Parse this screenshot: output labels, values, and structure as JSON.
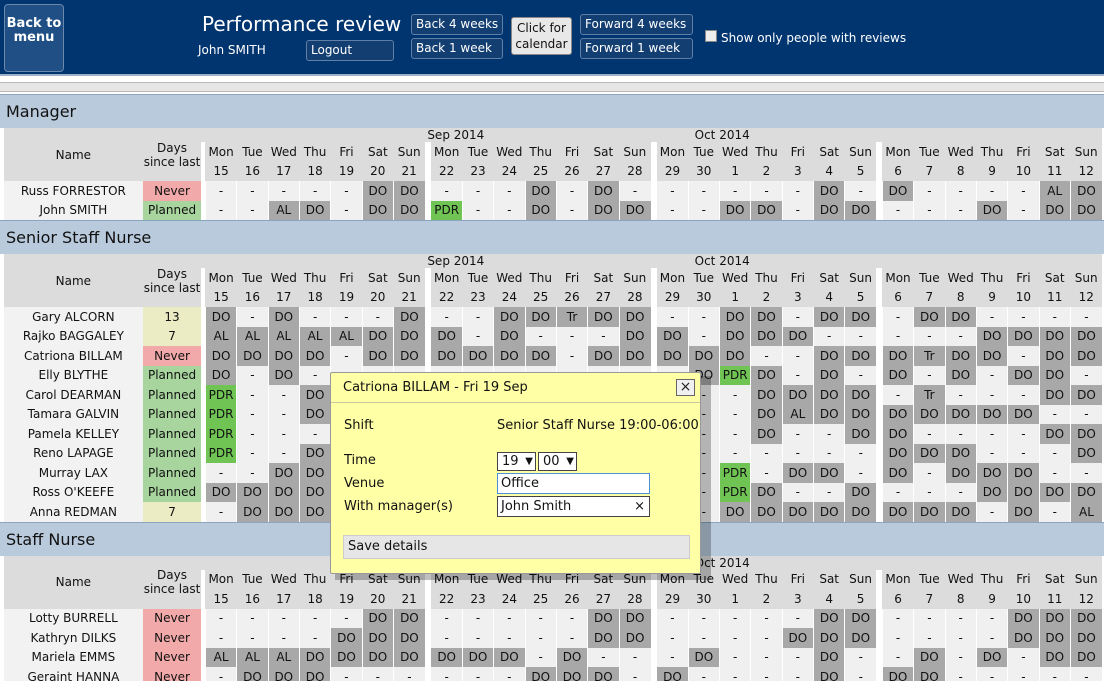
{
  "header": {
    "back_label": "Back to menu",
    "title": "Performance review",
    "user": "John SMITH",
    "logout": "Logout",
    "back4": "Back 4 weeks",
    "back1": "Back 1 week",
    "calendar": "Click for calendar",
    "fwd4": "Forward 4 weeks",
    "fwd1": "Forward 1 week",
    "show_only": "Show only people with reviews"
  },
  "table_header": {
    "name": "Name",
    "days_since": "Days since last",
    "month1": "Sep 2014",
    "month2": "Oct 2014",
    "weeks": [
      [
        [
          "Mon",
          "15"
        ],
        [
          "Tue",
          "16"
        ],
        [
          "Wed",
          "17"
        ],
        [
          "Thu",
          "18"
        ],
        [
          "Fri",
          "19"
        ],
        [
          "Sat",
          "20"
        ],
        [
          "Sun",
          "21"
        ]
      ],
      [
        [
          "Mon",
          "22"
        ],
        [
          "Tue",
          "23"
        ],
        [
          "Wed",
          "24"
        ],
        [
          "Thu",
          "25"
        ],
        [
          "Fri",
          "26"
        ],
        [
          "Sat",
          "27"
        ],
        [
          "Sun",
          "28"
        ]
      ],
      [
        [
          "Mon",
          "29"
        ],
        [
          "Tue",
          "30"
        ],
        [
          "Wed",
          "1"
        ],
        [
          "Thu",
          "2"
        ],
        [
          "Fri",
          "3"
        ],
        [
          "Sat",
          "4"
        ],
        [
          "Sun",
          "5"
        ]
      ],
      [
        [
          "Mon",
          "6"
        ],
        [
          "Tue",
          "7"
        ],
        [
          "Wed",
          "8"
        ],
        [
          "Thu",
          "9"
        ],
        [
          "Fri",
          "10"
        ],
        [
          "Sat",
          "11"
        ],
        [
          "Sun",
          "12"
        ]
      ]
    ]
  },
  "sections": [
    {
      "title": "Manager",
      "rows": [
        {
          "name": "Russ FORRESTOR",
          "days": "Never",
          "cells": [
            "-",
            "-",
            "-",
            "-",
            "-",
            "DO",
            "DO",
            "-",
            "-",
            "-",
            "DO",
            "-",
            "DO",
            "-",
            "-",
            "-",
            "-",
            "-",
            "-",
            "DO",
            "-",
            "DO",
            "-",
            "-",
            "-",
            "-",
            "AL",
            "DO"
          ]
        },
        {
          "name": "John SMITH",
          "days": "Planned",
          "cells": [
            "-",
            "-",
            "AL",
            "DO",
            "-",
            "DO",
            "DO",
            "PDR",
            "-",
            "-",
            "DO",
            "-",
            "DO",
            "DO",
            "-",
            "-",
            "DO",
            "DO",
            "-",
            "DO",
            "DO",
            "-",
            "-",
            "-",
            "DO",
            "-",
            "DO",
            "DO"
          ]
        }
      ]
    },
    {
      "title": "Senior Staff Nurse",
      "rows": [
        {
          "name": "Gary ALCORN",
          "days": "13",
          "cells": [
            "DO",
            "-",
            "DO",
            "-",
            "-",
            "-",
            "DO",
            "-",
            "-",
            "DO",
            "DO",
            "Tr",
            "DO",
            "DO",
            "-",
            "-",
            "DO",
            "DO",
            "-",
            "DO",
            "DO",
            "-",
            "DO",
            "DO",
            "-",
            "-",
            "-",
            "-"
          ]
        },
        {
          "name": "Rajko BAGGALEY",
          "days": "7",
          "cells": [
            "AL",
            "AL",
            "AL",
            "AL",
            "AL",
            "DO",
            "DO",
            "DO",
            "-",
            "DO",
            "-",
            "-",
            "-",
            "DO",
            "DO",
            "-",
            "DO",
            "DO",
            "DO",
            "-",
            "-",
            "-",
            "-",
            "-",
            "DO",
            "DO",
            "DO",
            "DO"
          ]
        },
        {
          "name": "Catriona BILLAM",
          "days": "Never",
          "cells": [
            "DO",
            "DO",
            "DO",
            "DO",
            "-",
            "DO",
            "DO",
            "DO",
            "DO",
            "DO",
            "DO",
            "-",
            "DO",
            "DO",
            "DO",
            "DO",
            "DO",
            "-",
            "-",
            "DO",
            "DO",
            "DO",
            "Tr",
            "DO",
            "DO",
            "-",
            "DO",
            "DO"
          ]
        },
        {
          "name": "Elly BLYTHE",
          "days": "Planned",
          "cells": [
            "DO",
            "-",
            "DO",
            "-",
            "-",
            "-",
            "-",
            "-",
            "-",
            "-",
            "-",
            "-",
            "-",
            "-",
            "-",
            "DO",
            "PDR",
            "DO",
            "-",
            "DO",
            "-",
            "DO",
            "-",
            "DO",
            "-",
            "DO",
            "DO",
            "-"
          ]
        },
        {
          "name": "Carol DEARMAN",
          "days": "Planned",
          "cells": [
            "PDR",
            "-",
            "-",
            "DO",
            "-",
            "-",
            "-",
            "-",
            "-",
            "-",
            "-",
            "-",
            "-",
            "-",
            "-",
            "-",
            "-",
            "DO",
            "DO",
            "DO",
            "DO",
            "-",
            "Tr",
            "-",
            "-",
            "-",
            "DO",
            "DO"
          ]
        },
        {
          "name": "Tamara GALVIN",
          "days": "Planned",
          "cells": [
            "PDR",
            "-",
            "-",
            "DO",
            "-",
            "-",
            "-",
            "-",
            "-",
            "-",
            "-",
            "-",
            "-",
            "-",
            "-",
            "-",
            "-",
            "DO",
            "AL",
            "DO",
            "DO",
            "DO",
            "DO",
            "DO",
            "DO",
            "DO",
            "-",
            "-"
          ]
        },
        {
          "name": "Pamela KELLEY",
          "days": "Planned",
          "cells": [
            "PDR",
            "-",
            "-",
            "-",
            "-",
            "-",
            "-",
            "-",
            "-",
            "-",
            "-",
            "-",
            "-",
            "-",
            "-",
            "-",
            "-",
            "DO",
            "-",
            "-",
            "DO",
            "DO",
            "-",
            "-",
            "-",
            "-",
            "DO",
            "DO"
          ]
        },
        {
          "name": "Reno LAPAGE",
          "days": "Planned",
          "cells": [
            "PDR",
            "-",
            "-",
            "DO",
            "-",
            "-",
            "-",
            "-",
            "-",
            "-",
            "-",
            "-",
            "-",
            "-",
            "-",
            "-",
            "-",
            "-",
            "-",
            "-",
            "-",
            "DO",
            "DO",
            "DO",
            "-",
            "-",
            "-",
            "DO"
          ]
        },
        {
          "name": "Murray LAX",
          "days": "Planned",
          "cells": [
            "-",
            "-",
            "DO",
            "DO",
            "-",
            "-",
            "-",
            "-",
            "-",
            "-",
            "-",
            "-",
            "-",
            "-",
            "-",
            "-",
            "PDR",
            "-",
            "DO",
            "DO",
            "-",
            "DO",
            "-",
            "DO",
            "DO",
            "DO",
            "-",
            "-"
          ]
        },
        {
          "name": "Ross O'KEEFE",
          "days": "Planned",
          "cells": [
            "DO",
            "DO",
            "DO",
            "DO",
            "-",
            "-",
            "-",
            "-",
            "-",
            "-",
            "-",
            "-",
            "-",
            "-",
            "-",
            "-",
            "PDR",
            "DO",
            "-",
            "-",
            "DO",
            "-",
            "-",
            "-",
            "DO",
            "DO",
            "DO",
            "DO"
          ]
        },
        {
          "name": "Anna REDMAN",
          "days": "7",
          "cells": [
            "-",
            "DO",
            "DO",
            "DO",
            "-",
            "-",
            "-",
            "-",
            "-",
            "-",
            "-",
            "-",
            "-",
            "-",
            "-",
            "-",
            "DO",
            "DO",
            "DO",
            "DO",
            "DO",
            "DO",
            "DO",
            "DO",
            "-",
            "DO",
            "-",
            "AL"
          ]
        }
      ]
    },
    {
      "title": "Staff Nurse",
      "rows": [
        {
          "name": "Lotty BURRELL",
          "days": "Never",
          "cells": [
            "-",
            "-",
            "-",
            "-",
            "-",
            "DO",
            "DO",
            "-",
            "-",
            "-",
            "-",
            "-",
            "DO",
            "DO",
            "-",
            "-",
            "-",
            "-",
            "-",
            "DO",
            "DO",
            "-",
            "-",
            "-",
            "-",
            "DO",
            "DO",
            "DO"
          ]
        },
        {
          "name": "Kathryn DILKS",
          "days": "Never",
          "cells": [
            "-",
            "-",
            "-",
            "-",
            "DO",
            "DO",
            "DO",
            "-",
            "-",
            "-",
            "-",
            "-",
            "DO",
            "DO",
            "-",
            "-",
            "-",
            "-",
            "DO",
            "DO",
            "DO",
            "-",
            "-",
            "-",
            "-",
            "DO",
            "DO",
            "DO"
          ]
        },
        {
          "name": "Mariela EMMS",
          "days": "Never",
          "cells": [
            "AL",
            "AL",
            "AL",
            "DO",
            "DO",
            "DO",
            "DO",
            "DO",
            "DO",
            "DO",
            "-",
            "DO",
            "-",
            "-",
            "-",
            "DO",
            "-",
            "-",
            "-",
            "DO",
            "-",
            "-",
            "DO",
            "-",
            "DO",
            "-",
            "DO",
            "DO"
          ]
        },
        {
          "name": "Geraint HANNA",
          "days": "Never",
          "cells": [
            "-",
            "DO",
            "DO",
            "DO",
            "-",
            "-",
            "-",
            "-",
            "-",
            "-",
            "DO",
            "DO",
            "DO",
            "-",
            "DO",
            "-",
            "-",
            "-",
            "-",
            "DO",
            "-",
            "DO",
            "DO",
            "-",
            "-",
            "-",
            "-",
            "-"
          ]
        }
      ]
    }
  ],
  "modal": {
    "title": "Catriona BILLAM - Fri 19 Sep",
    "shift_label": "Shift",
    "shift_value": "Senior Staff Nurse 19:00-06:00",
    "time_label": "Time",
    "hour": "19",
    "minute": "00",
    "venue_label": "Venue",
    "venue": "Office",
    "manager_label": "With manager(s)",
    "manager": "John Smith",
    "clear": "×",
    "save": "Save details",
    "close": "×"
  }
}
